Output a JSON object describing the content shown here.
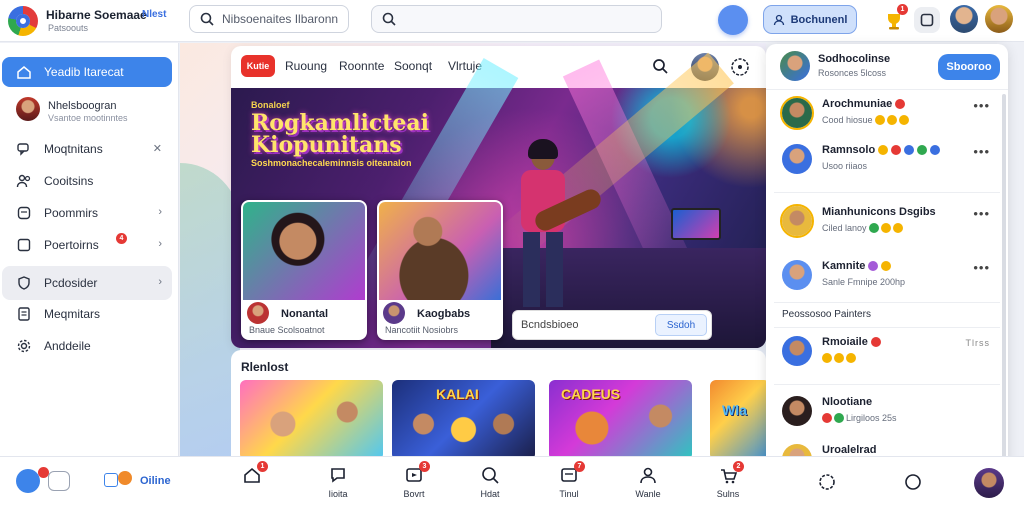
{
  "brand": {
    "title": "Hibarne Soemaae",
    "badge": "Nlest",
    "subtitle": "Patsoouts"
  },
  "search": {
    "main_placeholder": "Nibsoenaites Ilbaronn",
    "secondary_placeholder": ""
  },
  "header": {
    "button_label": "Bochunenl",
    "notification_count": "1",
    "colors": {
      "accent": "#3d84ea",
      "alert": "#e53935"
    }
  },
  "sidebar": {
    "active": "Yeadib Itarecat",
    "user": {
      "name": "Nhelsboogran",
      "subtitle": "Vsantoe mootinntes"
    },
    "items": [
      {
        "label": "Yeadib Itarecat",
        "icon": "home-icon",
        "chevron": ""
      },
      {
        "label": "Moqtnitans",
        "icon": "chat-icon",
        "chevron": "✕"
      },
      {
        "label": "Cooitsins",
        "icon": "users-icon",
        "chevron": ""
      },
      {
        "label": "Poommirs",
        "icon": "message-icon",
        "chevron": "›"
      },
      {
        "label": "Poertoirns",
        "icon": "bell-icon",
        "chevron": "›",
        "badge": "4"
      },
      {
        "label": "Pcdosider",
        "icon": "shield-icon",
        "chevron": "›"
      },
      {
        "label": "Meqmitars",
        "icon": "document-icon",
        "chevron": ""
      },
      {
        "label": "Anddeile",
        "icon": "gear-icon",
        "chevron": ""
      }
    ]
  },
  "card": {
    "badge": "Kutie",
    "tabs": [
      "Ruoung",
      "Roonnte",
      "Soonqt",
      "Vlrtuje"
    ],
    "hero": {
      "kicker": "Bonaloef",
      "title_line1": "Rogkamlicteai",
      "title_line2": "Kiopunitans",
      "subtitle": "Soshmonachecaleminnsis oiteanalon"
    },
    "performers": [
      {
        "name": "Nonantal",
        "subtitle": "Bnaue Scolsoatnot"
      },
      {
        "name": "Kaogbabs",
        "subtitle": "Nancotiit Nosiobrs"
      }
    ],
    "input": {
      "placeholder": "Bcndsbioeo",
      "button": "Ssdoh"
    }
  },
  "recent": {
    "title": "Rlenlost",
    "thumbs": [
      {
        "label": ""
      },
      {
        "label": "KALAI"
      },
      {
        "label": "CADEUS"
      },
      {
        "label": "Wla"
      }
    ]
  },
  "panel": {
    "header": {
      "name": "Sodhocolinse",
      "subtitle": "Rosonces 5lcoss",
      "button": "Sbooroo"
    },
    "items": [
      {
        "name": "Arochmuniae",
        "sub": "Cood hiosue",
        "more": "•••"
      },
      {
        "name": "Ramnsolo",
        "sub": "Usoo riiaos",
        "more": "•••"
      },
      {
        "name": "Mianhunicons Dsgibs",
        "sub": "Ciled lanoy",
        "more": "•••"
      },
      {
        "name": "Kamnite",
        "sub": "Sanle Fmnipe 200hp",
        "more": "•••"
      }
    ],
    "section": {
      "title": "Peossosoo Painters"
    },
    "section_items": [
      {
        "name": "Rmoiaile",
        "sub": "",
        "meta": "Tlrss"
      },
      {
        "name": "Nlootiane",
        "sub": "Lirgiloos 25s",
        "meta": ""
      },
      {
        "name": "Uroalelrad",
        "sub": "",
        "meta": ""
      }
    ]
  },
  "bottom_bar": {
    "left": {
      "label": "Oiline"
    },
    "items": [
      {
        "label": "",
        "icon": "home-icon",
        "badge": "1"
      },
      {
        "label": "Iioita",
        "icon": "chat-icon",
        "badge": ""
      },
      {
        "label": "Bovrt",
        "icon": "video-icon",
        "badge": "3"
      },
      {
        "label": "Hdat",
        "icon": "search-icon",
        "badge": ""
      },
      {
        "label": "Tinul",
        "icon": "mail-icon",
        "badge": "7"
      },
      {
        "label": "Wanle",
        "icon": "user-icon",
        "badge": ""
      },
      {
        "label": "Sulns",
        "icon": "cart-icon",
        "badge": "2"
      }
    ]
  }
}
